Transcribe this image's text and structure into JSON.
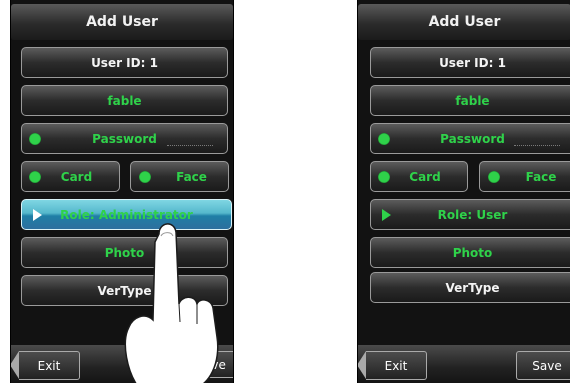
{
  "left_screen": {
    "title": "Add User",
    "user_id": "User ID: 1",
    "name": "fable",
    "password": "Password",
    "card": "Card",
    "face": "Face",
    "role": "Role: Administrator",
    "photo": "Photo",
    "vertype": "VerType",
    "exit": "Exit",
    "save": "Save",
    "save_visible": "ave"
  },
  "right_screen": {
    "title": "Add User",
    "user_id": "User ID: 1",
    "name": "fable",
    "password": "Password",
    "card": "Card",
    "face": "Face",
    "role": "Role: User",
    "photo": "Photo",
    "vertype": "VerType",
    "exit": "Exit",
    "save": "Save"
  },
  "colors": {
    "accent_green": "#2fd24a",
    "selected_blue": "#55b8cc",
    "background": "#121212"
  },
  "icons": [
    "status-dot-icon",
    "selection-arrow-icon",
    "back-arrow-icon",
    "pointing-hand-icon"
  ]
}
